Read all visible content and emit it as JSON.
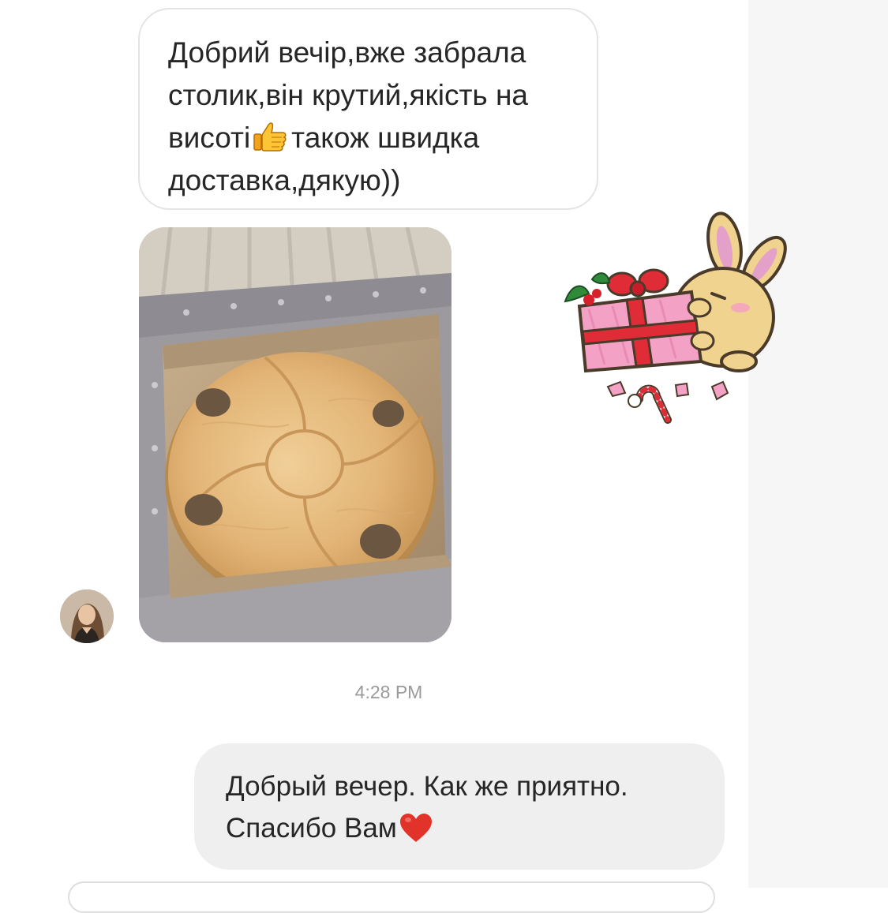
{
  "messages": {
    "incoming_text": {
      "line1": "Добрий вечір,вже забрала",
      "line2": "столик,він крутий,якість на",
      "line3_before_emoji": "висоті",
      "line3_after_emoji": "також швидка",
      "line4": "доставка,дякую))",
      "emoji": "thumbs-up-icon"
    },
    "incoming_photo": {
      "subject": "round wooden wine table in box"
    },
    "sticker": {
      "icon": "bunny-gift-sticker-icon"
    },
    "timestamp": "4:28 PM",
    "outgoing_text": {
      "line1": "Добрый вечер. Как же приятно.",
      "line2_before_emoji": "Спасибо Вам",
      "emoji": "heart-icon"
    }
  },
  "colors": {
    "incoming_bubble_bg": "#ffffff",
    "incoming_bubble_border": "#e4e4e4",
    "outgoing_bubble_bg": "#efefef",
    "text": "#262626",
    "timestamp": "#9a9a9a"
  }
}
